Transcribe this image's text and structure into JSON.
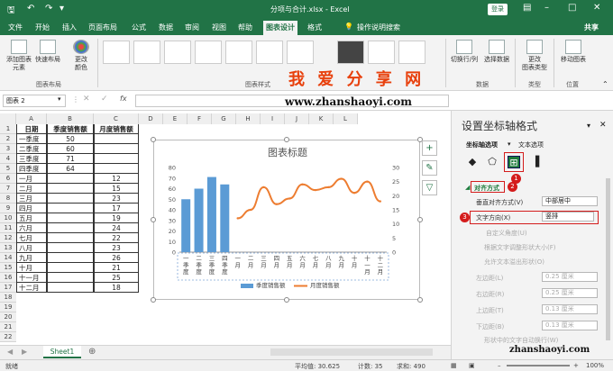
{
  "window": {
    "title": "分项与合计.xlsx  -  Excel",
    "search_placeholder": "操作说明搜索",
    "login": "登录"
  },
  "menu": [
    "文件",
    "开始",
    "插入",
    "页面布局",
    "公式",
    "数据",
    "审阅",
    "视图",
    "帮助",
    "图表设计",
    "格式"
  ],
  "menu_active": "图表设计",
  "share": "共享",
  "ribbon": {
    "add_element": "添加图表\n元素",
    "quick_layout": "快速布局",
    "change_color": "更改\n颜色",
    "group_layout": "图表布局",
    "group_styles": "图表样式",
    "switch_rowcol": "切换行/列",
    "select_data": "选择数据",
    "group_data": "数据",
    "change_type": "更改\n图表类型",
    "group_type": "类型",
    "move_chart": "移动图表",
    "group_location": "位置"
  },
  "formula_bar": {
    "namebox": "图表 2",
    "fx": "fx"
  },
  "watermark": {
    "line1": "我 爱 分 享 网",
    "line2": "www.zhanshaoyi.com",
    "corner": "zhanshaoyi.com"
  },
  "sheet": {
    "columns": [
      "A",
      "B",
      "C",
      "D",
      "E",
      "F",
      "G",
      "H",
      "I",
      "J",
      "K",
      "L"
    ],
    "headers": {
      "A": "日期",
      "B": "季度销售额",
      "C": "月度销售额"
    },
    "rows": [
      {
        "a": "一季度",
        "b": "50",
        "c": ""
      },
      {
        "a": "二季度",
        "b": "60",
        "c": ""
      },
      {
        "a": "三季度",
        "b": "71",
        "c": ""
      },
      {
        "a": "四季度",
        "b": "64",
        "c": ""
      },
      {
        "a": "一月",
        "b": "",
        "c": "12"
      },
      {
        "a": "二月",
        "b": "",
        "c": "15"
      },
      {
        "a": "三月",
        "b": "",
        "c": "23"
      },
      {
        "a": "四月",
        "b": "",
        "c": "17"
      },
      {
        "a": "五月",
        "b": "",
        "c": "19"
      },
      {
        "a": "六月",
        "b": "",
        "c": "24"
      },
      {
        "a": "七月",
        "b": "",
        "c": "22"
      },
      {
        "a": "八月",
        "b": "",
        "c": "23"
      },
      {
        "a": "九月",
        "b": "",
        "c": "26"
      },
      {
        "a": "十月",
        "b": "",
        "c": "21"
      },
      {
        "a": "十一月",
        "b": "",
        "c": "25"
      },
      {
        "a": "十二月",
        "b": "",
        "c": "18"
      }
    ],
    "row_numbers": [
      "1",
      "2",
      "3",
      "4",
      "5",
      "6",
      "7",
      "8",
      "9",
      "10",
      "11",
      "12",
      "13",
      "14",
      "15",
      "16",
      "17",
      "18",
      "19",
      "20",
      "21",
      "22"
    ],
    "tab": "Sheet1"
  },
  "chart_data": {
    "type": "bar",
    "title": "图表标题",
    "categories": [
      "一季度",
      "二季度",
      "三季度",
      "四季度",
      "一月",
      "二月",
      "三月",
      "四月",
      "五月",
      "六月",
      "七月",
      "八月",
      "九月",
      "十月",
      "十一月",
      "十二月"
    ],
    "series": [
      {
        "name": "季度销售额",
        "type": "bar",
        "axis": "left",
        "color": "#5b9bd5",
        "values": [
          50,
          60,
          71,
          64,
          null,
          null,
          null,
          null,
          null,
          null,
          null,
          null,
          null,
          null,
          null,
          null
        ]
      },
      {
        "name": "月度销售额",
        "type": "line",
        "axis": "right",
        "color": "#ed7d31",
        "values": [
          null,
          null,
          null,
          null,
          12,
          15,
          23,
          17,
          19,
          24,
          22,
          23,
          26,
          21,
          25,
          18
        ]
      }
    ],
    "y_left": {
      "min": 0,
      "max": 80,
      "ticks": [
        "0",
        "10",
        "20",
        "30",
        "40",
        "50",
        "60",
        "70",
        "80"
      ]
    },
    "y_right": {
      "min": 0,
      "max": 30,
      "ticks": [
        "0",
        "5",
        "10",
        "15",
        "20",
        "25",
        "30"
      ]
    },
    "legend": "bottom",
    "grid": false
  },
  "panel": {
    "title": "设置坐标轴格式",
    "tab_options": "坐标轴选项",
    "tab_text": "文本选项",
    "section": "对齐方式",
    "vertical_align_label": "垂直对齐方式(V)",
    "vertical_align_value": "中部居中",
    "text_dir_label": "文字方向(X)",
    "text_dir_value": "竖排",
    "custom_angle": "自定义角度(U)",
    "opt1": "根据文字调整形状大小(F)",
    "opt2": "允许文本溢出形状(O)",
    "left_margin": "左边距(L)",
    "right_margin": "右边距(R)",
    "top_margin": "上边距(T)",
    "bottom_margin": "下边距(B)",
    "m_lr": "0.25 厘米",
    "m_tb": "0.13 厘米",
    "wrap": "形状中的文字自动换行(W)",
    "badges": [
      "1",
      "2",
      "3"
    ]
  },
  "status": {
    "ready": "就绪",
    "average": "平均值: 30.625",
    "count": "计数: 35",
    "sum": "求和: 490",
    "zoom": "100%"
  }
}
